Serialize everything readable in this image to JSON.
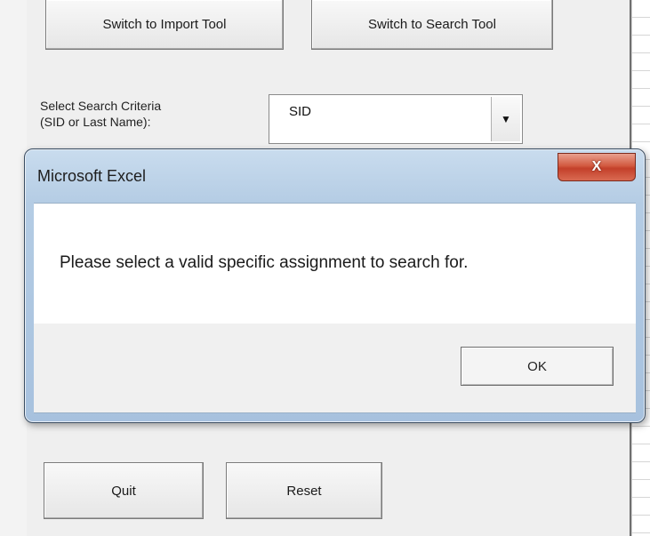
{
  "form": {
    "switch_import_label": "Switch to Import Tool",
    "switch_search_label": "Switch to Search Tool",
    "criteria_label_line1": "Select Search Criteria",
    "criteria_label_line2": "(SID or Last Name):",
    "criteria_value": "SID",
    "quit_label": "Quit",
    "reset_label": "Reset"
  },
  "dialog": {
    "title": "Microsoft Excel",
    "close_glyph": "X",
    "message": "Please select a valid specific assignment to search for.",
    "ok_label": "OK"
  },
  "colors": {
    "dialog_frame": "#b4cce4",
    "close_button": "#c3402a"
  }
}
